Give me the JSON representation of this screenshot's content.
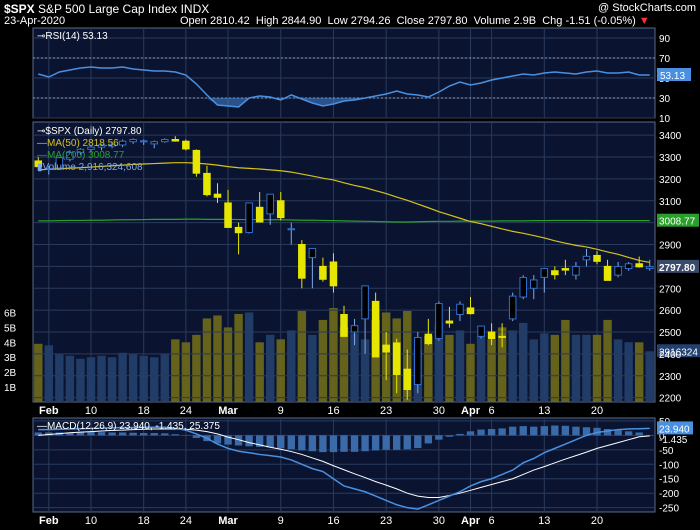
{
  "header": {
    "symbol": "$SPX",
    "name": "S&P 500 Large Cap Index",
    "exchange": "INDX",
    "date": "23-Apr-2020",
    "open_label": "Open",
    "open": "2810.42",
    "high_label": "High",
    "high": "2844.90",
    "low_label": "Low",
    "low": "2794.26",
    "close_label": "Close",
    "close": "2797.80",
    "volume_label": "Volume",
    "volume": "2.9B",
    "chg_label": "Chg",
    "chg": "-1.51 (-0.05%)",
    "chg_arrow": "▼",
    "copyright": "@ StockCharts.com"
  },
  "colors": {
    "background": "#000000",
    "panel": "#0a1430",
    "grid": "#2a3a5c",
    "up": "#2f6fcf",
    "down": "#e6e600",
    "ma50": "#d6c21a",
    "ma200": "#2aa02a",
    "rsi": "#4a90e0",
    "macd": "#4a90e0",
    "signal": "#ffffff"
  },
  "chart_data": [
    {
      "type": "line",
      "legend": "RSI(14) 53.13",
      "last_value": "53.13",
      "ylim": [
        10,
        100
      ],
      "yticks": [
        90,
        70,
        50,
        30,
        10
      ],
      "overbought": 70,
      "oversold": 30,
      "values": [
        54,
        51,
        56,
        58,
        60,
        61,
        60,
        60,
        61,
        59,
        58,
        57,
        57,
        56,
        53,
        44,
        33,
        23,
        22,
        21,
        30,
        32,
        31,
        28,
        33,
        29,
        25,
        22,
        24,
        27,
        28,
        30,
        32,
        34,
        37,
        34,
        33,
        31,
        36,
        42,
        46,
        43,
        45,
        48,
        50,
        52,
        54,
        53,
        55,
        56,
        55,
        54,
        56,
        57,
        55,
        55,
        56,
        53,
        53
      ]
    },
    {
      "type": "candlestick",
      "legend": {
        "price": "$SPX (Daily) 2797.80",
        "ma50": "MA(50) 2818.56",
        "ma200": "MA(200) 3008.77",
        "volume": "Volume 2,916,324,608"
      },
      "last_close": "2797.80",
      "ma200_last": "3008.77",
      "ma50_last": "2818.56",
      "ylim": [
        2180,
        3460
      ],
      "yticks": [
        3400,
        3300,
        3200,
        3100,
        3000,
        2900,
        2800,
        2700,
        2600,
        2500,
        2400,
        2300,
        2200
      ],
      "volume_ticks": [
        "6B",
        "5B",
        "4B",
        "3B",
        "2B",
        "1B"
      ],
      "volume_last": "2916324",
      "x_labels": [
        {
          "label": "Feb",
          "i": 1
        },
        {
          "label": "10",
          "i": 5
        },
        {
          "label": "18",
          "i": 10
        },
        {
          "label": "24",
          "i": 14
        },
        {
          "label": "Mar",
          "i": 18
        },
        {
          "label": "9",
          "i": 23
        },
        {
          "label": "16",
          "i": 28
        },
        {
          "label": "23",
          "i": 33
        },
        {
          "label": "30",
          "i": 38
        },
        {
          "label": "Apr",
          "i": 41
        },
        {
          "label": "6",
          "i": 43
        },
        {
          "label": "13",
          "i": 48
        },
        {
          "label": "20",
          "i": 53
        }
      ],
      "ohlc": [
        [
          3282,
          3300,
          3240,
          3256
        ],
        [
          3245,
          3260,
          3220,
          3248
        ],
        [
          3250,
          3300,
          3245,
          3297
        ],
        [
          3290,
          3330,
          3280,
          3320
        ],
        [
          3320,
          3340,
          3310,
          3335
        ],
        [
          3335,
          3350,
          3320,
          3345
        ],
        [
          3345,
          3360,
          3330,
          3355
        ],
        [
          3350,
          3370,
          3340,
          3358
        ],
        [
          3355,
          3380,
          3345,
          3372
        ],
        [
          3370,
          3385,
          3360,
          3380
        ],
        [
          3370,
          3380,
          3355,
          3374
        ],
        [
          3360,
          3375,
          3340,
          3370
        ],
        [
          3370,
          3385,
          3365,
          3380
        ],
        [
          3380,
          3395,
          3370,
          3373
        ],
        [
          3372,
          3380,
          3330,
          3337
        ],
        [
          3330,
          3335,
          3210,
          3226
        ],
        [
          3225,
          3260,
          3120,
          3128
        ],
        [
          3130,
          3180,
          3090,
          3116
        ],
        [
          3090,
          3150,
          2980,
          2978
        ],
        [
          2978,
          3000,
          2855,
          2954
        ],
        [
          2955,
          3090,
          2950,
          3090
        ],
        [
          3070,
          3140,
          3000,
          3003
        ],
        [
          3040,
          3130,
          2990,
          3130
        ],
        [
          3100,
          3140,
          3010,
          3023
        ],
        [
          2970,
          3000,
          2900,
          2972
        ],
        [
          2900,
          2920,
          2700,
          2746
        ],
        [
          2840,
          2880,
          2700,
          2882
        ],
        [
          2800,
          2840,
          2730,
          2741
        ],
        [
          2820,
          2860,
          2680,
          2711
        ],
        [
          2580,
          2620,
          2480,
          2480
        ],
        [
          2500,
          2560,
          2440,
          2529
        ],
        [
          2560,
          2700,
          2400,
          2711
        ],
        [
          2640,
          2680,
          2460,
          2386
        ],
        [
          2440,
          2500,
          2280,
          2409
        ],
        [
          2450,
          2470,
          2220,
          2305
        ],
        [
          2330,
          2420,
          2190,
          2237
        ],
        [
          2260,
          2500,
          2220,
          2475
        ],
        [
          2490,
          2560,
          2440,
          2447
        ],
        [
          2470,
          2640,
          2460,
          2630
        ],
        [
          2550,
          2615,
          2520,
          2541
        ],
        [
          2580,
          2640,
          2550,
          2627
        ],
        [
          2610,
          2660,
          2580,
          2584
        ],
        [
          2480,
          2530,
          2470,
          2527
        ],
        [
          2500,
          2540,
          2440,
          2470
        ],
        [
          2480,
          2540,
          2430,
          2477
        ],
        [
          2560,
          2680,
          2550,
          2664
        ],
        [
          2660,
          2760,
          2650,
          2749
        ],
        [
          2700,
          2760,
          2650,
          2738
        ],
        [
          2750,
          2780,
          2680,
          2790
        ],
        [
          2780,
          2800,
          2740,
          2762
        ],
        [
          2790,
          2830,
          2760,
          2783
        ],
        [
          2760,
          2820,
          2740,
          2799
        ],
        [
          2830,
          2880,
          2800,
          2846
        ],
        [
          2850,
          2870,
          2810,
          2823
        ],
        [
          2800,
          2830,
          2780,
          2736
        ],
        [
          2760,
          2820,
          2750,
          2799
        ],
        [
          2790,
          2820,
          2780,
          2812
        ],
        [
          2812,
          2845,
          2794,
          2798
        ],
        [
          2790,
          2830,
          2780,
          2798
        ]
      ],
      "ma50": [
        3241,
        3244,
        3246,
        3249,
        3251,
        3254,
        3257,
        3260,
        3263,
        3266,
        3268,
        3270,
        3272,
        3274,
        3274,
        3272,
        3268,
        3263,
        3256,
        3251,
        3248,
        3245,
        3241,
        3237,
        3231,
        3222,
        3213,
        3203,
        3195,
        3182,
        3170,
        3160,
        3146,
        3133,
        3117,
        3102,
        3085,
        3068,
        3050,
        3035,
        3020,
        3005,
        2995,
        2983,
        2971,
        2960,
        2951,
        2941,
        2930,
        2917,
        2906,
        2896,
        2889,
        2878,
        2866,
        2855,
        2841,
        2827,
        2818
      ],
      "ma200": [
        3008,
        3008,
        3009,
        3010,
        3010,
        3011,
        3011,
        3012,
        3013,
        3013,
        3014,
        3015,
        3015,
        3015,
        3016,
        3016,
        3015,
        3015,
        3015,
        3014,
        3014,
        3014,
        3013,
        3013,
        3012,
        3011,
        3011,
        3010,
        3009,
        3008,
        3007,
        3006,
        3005,
        3004,
        3003,
        3003,
        3004,
        3005,
        3006,
        3006,
        3007,
        3007,
        3007,
        3007,
        3008,
        3008,
        3008,
        3009,
        3009,
        3010,
        3010,
        3010,
        3010,
        3009,
        3009,
        3009,
        3009,
        3009,
        3009
      ],
      "volume": [
        3.9,
        3.8,
        3.2,
        3.1,
        2.9,
        3.0,
        3.1,
        3.0,
        3.3,
        3.2,
        3.1,
        3.0,
        3.2,
        4.2,
        4.0,
        4.5,
        5.6,
        5.8,
        5.0,
        5.9,
        6.0,
        4.0,
        4.5,
        4.2,
        4.8,
        6.1,
        4.5,
        5.5,
        6.3,
        5.0,
        4.6,
        4.2,
        5.5,
        6.0,
        5.6,
        6.1,
        3.5,
        4.4,
        5.3,
        4.5,
        4.8,
        3.9,
        4.4,
        4.2,
        5.0,
        4.8,
        5.3,
        4.2,
        4.6,
        4.5,
        5.5,
        4.5,
        4.5,
        4.5,
        5.5,
        4.2,
        4.0,
        4.0,
        3.4
      ]
    },
    {
      "type": "line",
      "legend": "MACD(12,26,9) 23.940, -1.435, 25.375",
      "macd_last": "23.940",
      "hist_last": "-1.435",
      "ylim": [
        -265,
        60
      ],
      "yticks": [
        50,
        0,
        -50,
        -100,
        -150,
        -200,
        -250
      ],
      "macd": [
        20,
        20,
        21,
        22,
        23,
        24,
        25,
        26,
        27,
        27,
        28,
        28,
        28,
        24,
        18,
        5,
        -10,
        -30,
        -45,
        -55,
        -60,
        -66,
        -70,
        -75,
        -85,
        -100,
        -115,
        -125,
        -150,
        -175,
        -185,
        -195,
        -210,
        -225,
        -240,
        -250,
        -255,
        -240,
        -225,
        -210,
        -195,
        -175,
        -160,
        -150,
        -135,
        -120,
        -95,
        -80,
        -60,
        -45,
        -30,
        -15,
        0,
        10,
        15,
        20,
        22,
        23,
        23.94
      ],
      "signal": [
        0,
        3,
        6,
        9,
        11,
        13,
        15,
        17,
        18,
        20,
        21,
        22,
        22,
        22,
        21,
        18,
        13,
        5,
        -6,
        -15,
        -25,
        -33,
        -41,
        -48,
        -56,
        -66,
        -78,
        -90,
        -105,
        -119,
        -133,
        -146,
        -160,
        -172,
        -185,
        -200,
        -210,
        -215,
        -215,
        -208,
        -200,
        -190,
        -180,
        -170,
        -160,
        -150,
        -135,
        -120,
        -108,
        -95,
        -82,
        -70,
        -58,
        -45,
        -35,
        -25,
        -15,
        -5,
        25.375
      ],
      "histogram": [
        10,
        10,
        10,
        10,
        11,
        12,
        11,
        10,
        10,
        9,
        8,
        8,
        7,
        4,
        1,
        -9,
        -20,
        -28,
        -32,
        -35,
        -38,
        -40,
        -42,
        -45,
        -48,
        -52,
        -55,
        -58,
        -58,
        -57,
        -57,
        -55,
        -52,
        -50,
        -50,
        -48,
        -44,
        -28,
        -15,
        -5,
        5,
        14,
        20,
        22,
        24,
        30,
        32,
        30,
        32,
        34,
        33,
        30,
        28,
        26,
        22,
        18,
        14,
        10,
        -1.435
      ]
    }
  ]
}
